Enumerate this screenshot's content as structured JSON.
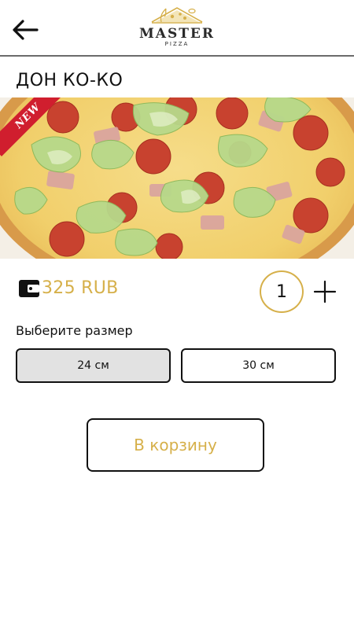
{
  "header": {
    "logo_title": "MASTER",
    "logo_subtitle": "PIZZA"
  },
  "product": {
    "title": "ДОН КО-КО",
    "badge": "NEW",
    "price": "325 RUB",
    "quantity": "1"
  },
  "size_selector": {
    "label": "Выберите размер",
    "options": [
      {
        "label": "24 см",
        "selected": true
      },
      {
        "label": "30 см",
        "selected": false
      }
    ]
  },
  "actions": {
    "add_to_cart": "В корзину"
  },
  "colors": {
    "accent": "#d6b04a",
    "badge": "#d01e2e",
    "selected_bg": "#e2e2e2"
  }
}
